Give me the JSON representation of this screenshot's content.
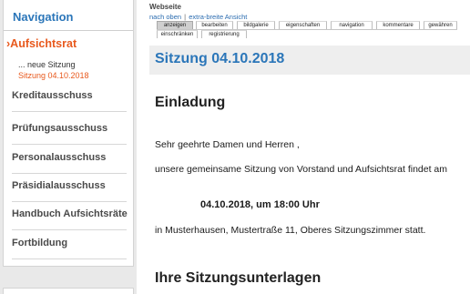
{
  "sidebar": {
    "header": "Navigation",
    "active_item": "Aufsichtsrat",
    "sub_items": [
      "... neue Sitzung",
      "Sitzung 04.10.2018"
    ],
    "items": [
      "Kreditausschuss",
      "Prüfungsausschuss",
      "Personalausschuss",
      "Präsidialausschuss",
      "Handbuch Aufsichtsräte",
      "Fortbildung"
    ]
  },
  "main": {
    "section_label": "Webseite",
    "links": {
      "back_to_top": "nach oben",
      "separator": "|",
      "wide_view": "extra-breite Ansicht"
    },
    "tabs": [
      "anzeigen",
      "bearbeiten",
      "bildgalerie",
      "eigenschaften",
      "navigation",
      "kommentare",
      "gewähren",
      "einschränken",
      "registrierung"
    ],
    "page_title": "Sitzung 04.10.2018",
    "invitation_heading": "Einladung",
    "salutation": "Sehr geehrte Damen und Herren ,",
    "body_text": "unsere gemeinsame Sitzung von Vorstand und Aufsichtsrat findet am",
    "date_time": "04.10.2018, um 18:00 Uhr",
    "location_text": "in Musterhausen, Mustertraße 11, Oberes Sitzungszimmer statt.",
    "documents_heading": "Ihre Sitzungsunterlagen"
  },
  "colors": {
    "accent_blue": "#2b76b9",
    "active_orange": "#e8591d",
    "sidebar_background": "#e9e9e9",
    "title_band": "#eeeeee"
  }
}
